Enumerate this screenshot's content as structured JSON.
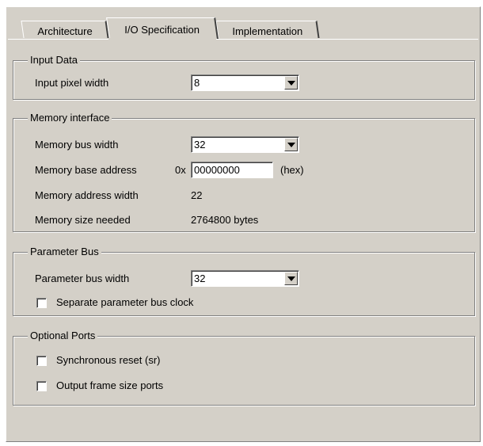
{
  "tabs": [
    {
      "label": "Architecture"
    },
    {
      "label": "I/O Specification"
    },
    {
      "label": "Implementation"
    }
  ],
  "input_data": {
    "legend": "Input Data",
    "pixel_width_label": "Input pixel width",
    "pixel_width_value": "8"
  },
  "memory": {
    "legend": "Memory interface",
    "bus_width_label": "Memory bus width",
    "bus_width_value": "32",
    "base_address_label": "Memory base address",
    "base_address_prefix": "0x",
    "base_address_value": "00000000",
    "base_address_suffix": "(hex)",
    "address_width_label": "Memory address width",
    "address_width_value": "22",
    "size_label": "Memory size needed",
    "size_value": "2764800 bytes"
  },
  "param_bus": {
    "legend": "Parameter Bus",
    "bus_width_label": "Parameter bus width",
    "bus_width_value": "32",
    "separate_clock_label": "Separate parameter bus clock",
    "separate_clock_checked": false
  },
  "optional_ports": {
    "legend": "Optional Ports",
    "sync_reset_label": "Synchronous reset (sr)",
    "sync_reset_checked": false,
    "frame_size_label": "Output frame size ports",
    "frame_size_checked": false
  },
  "colors": {
    "panel_bg": "#d4d0c8",
    "shadow": "#808080",
    "highlight": "#ffffff"
  },
  "icons": {
    "dropdown": "chevron-down-icon",
    "checkbox": "checkbox-unchecked"
  }
}
